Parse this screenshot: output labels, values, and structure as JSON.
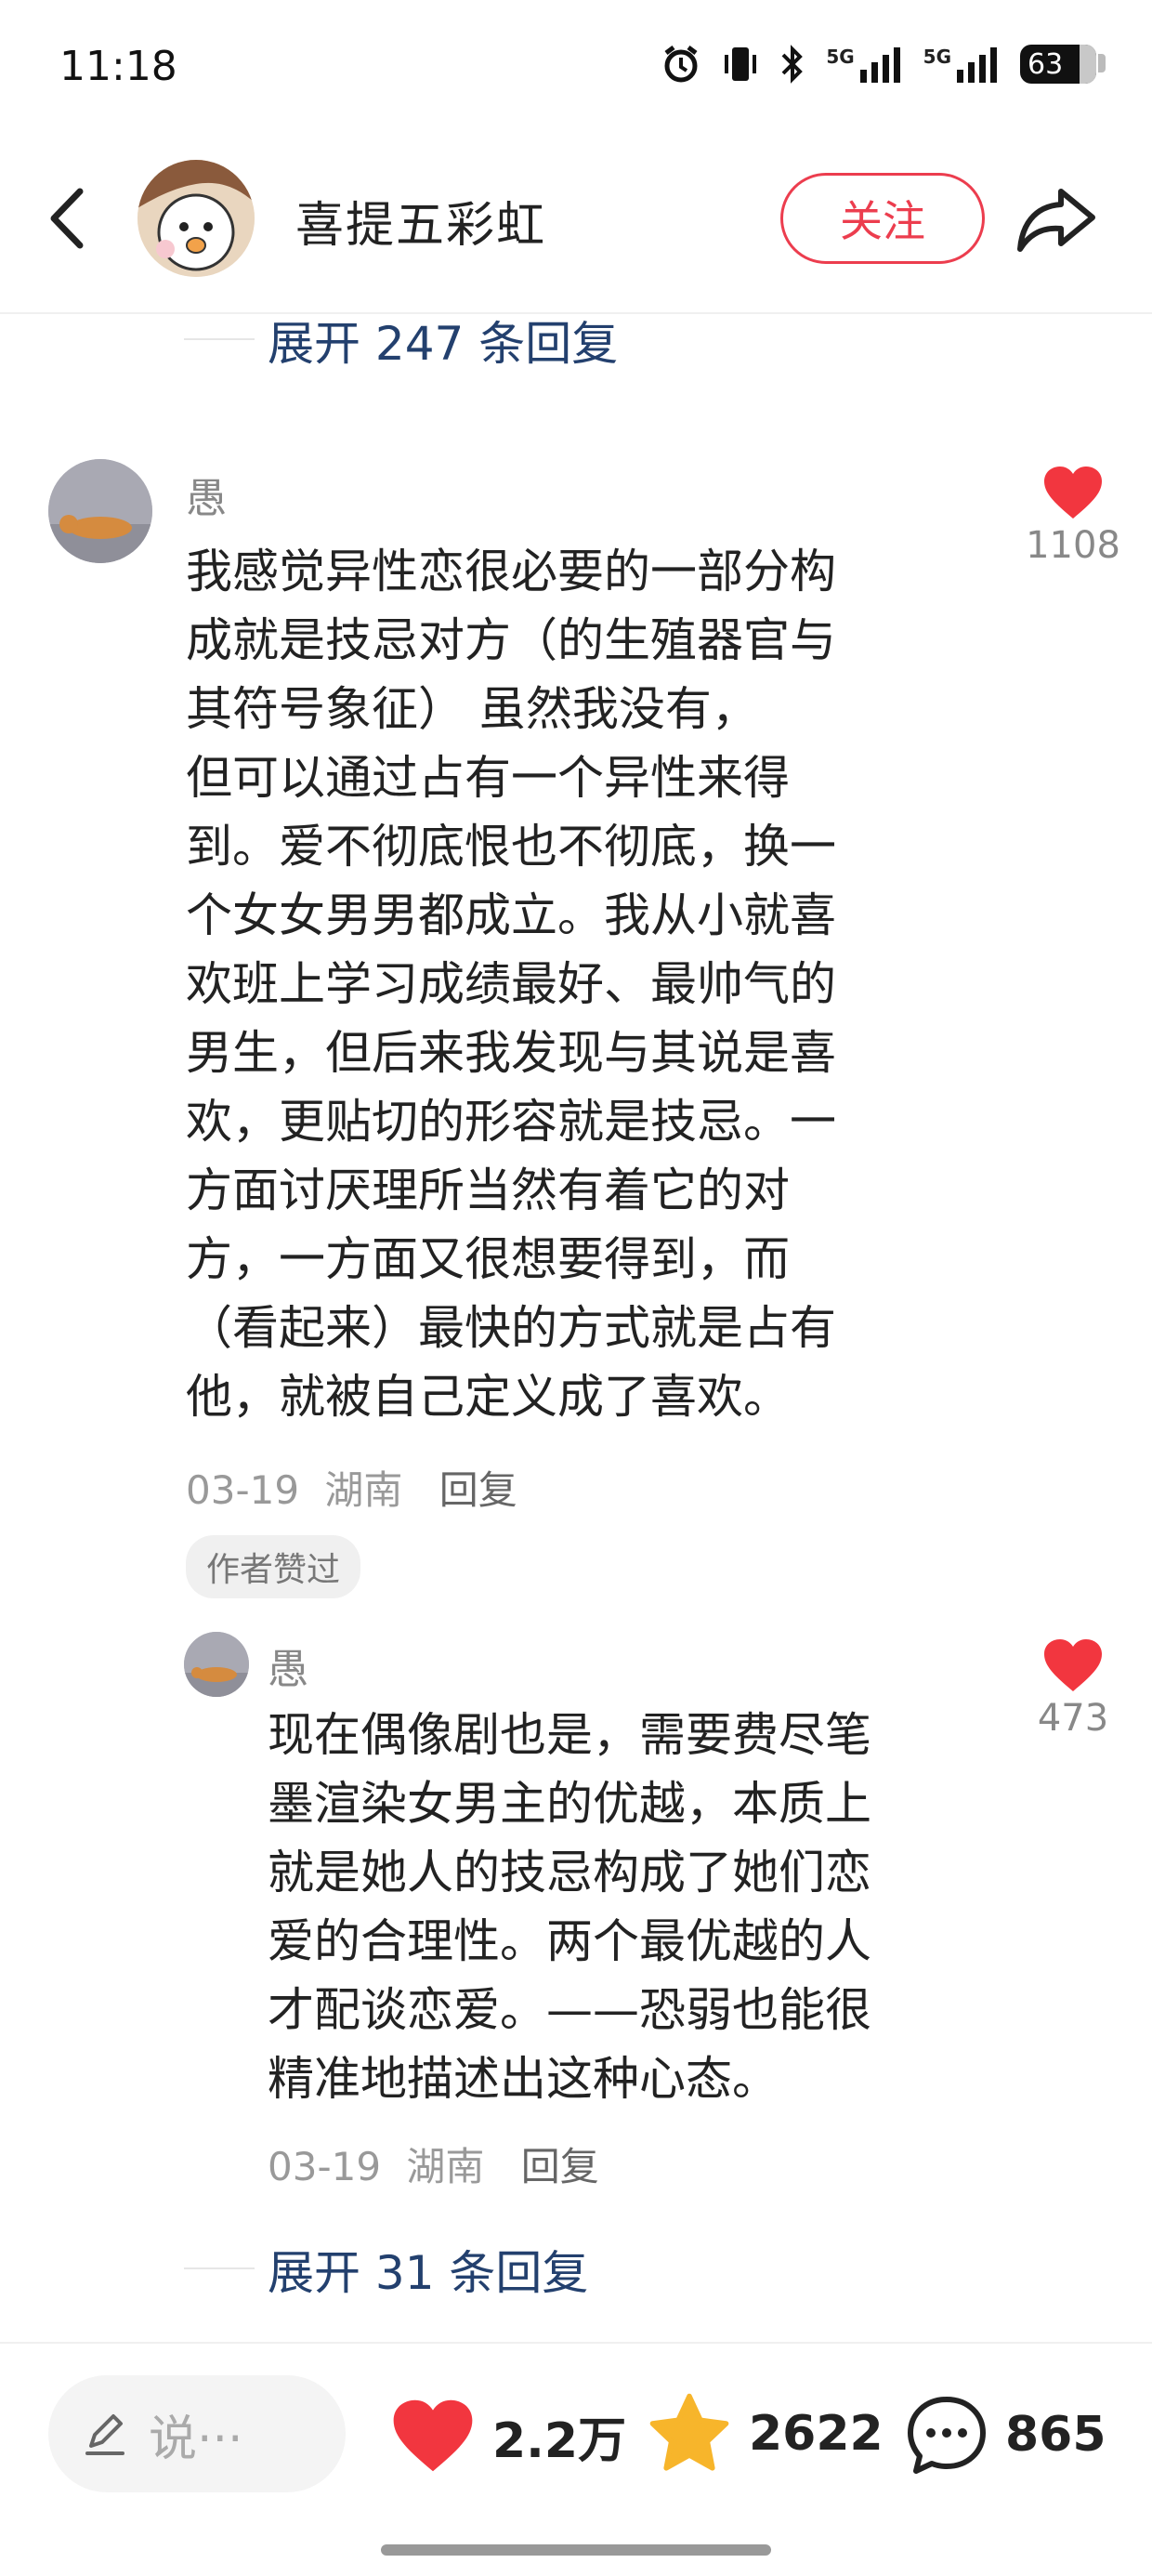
{
  "status_bar": {
    "time": "11:18",
    "battery": "63",
    "signal1": "5G",
    "signal2": "5G"
  },
  "header": {
    "author_name": "喜提五彩虹",
    "follow_label": "关注"
  },
  "top_expand": {
    "label": "展开 247 条回复"
  },
  "comment_main": {
    "name": "愚",
    "lines": [
      "我感觉异性恋很必要的一部分构",
      "成就是技忌对方（的生殖器官与",
      "其符号象征）     虽然我没有，",
      "但可以通过占有一个异性来得",
      "到。爱不彻底恨也不彻底，换一",
      "个女女男男都成立。我从小就喜",
      "欢班上学习成绩最好、最帅气的",
      "男生，但后来我发现与其说是喜",
      "欢，更贴切的形容就是技忌。一",
      "方面讨厌理所当然有着它的对",
      "方，一方面又很想要得到，而",
      "（看起来）最快的方式就是占有",
      "他，就被自己定义成了喜欢。"
    ],
    "date": "03-19",
    "location": "湖南",
    "reply_label": "回复",
    "badge": "作者赞过",
    "likes": "1108"
  },
  "comment_reply": {
    "name": "愚",
    "lines": [
      "现在偶像剧也是，需要费尽笔",
      "墨渲染女男主的优越，本质上",
      "就是她人的技忌构成了她们恋",
      "爱的合理性。两个最优越的人",
      "才配谈恋爱。——恐弱也能很",
      "精准地描述出这种心态。"
    ],
    "date": "03-19",
    "location": "湖南",
    "reply_label": "回复",
    "likes": "473"
  },
  "bottom_expand": {
    "label": "展开 31 条回复"
  },
  "bottom_bar": {
    "input_placeholder": "说···",
    "likes": "2.2万",
    "favorites": "2622",
    "comments": "865"
  },
  "colors": {
    "accent_red": "#ec3d4e",
    "link_blue": "#23406e",
    "star": "#f7b52b"
  },
  "icons": [
    "back-icon",
    "share-icon",
    "heart-icon",
    "star-icon",
    "comment-icon",
    "pencil-icon",
    "alarm-icon",
    "bluetooth-icon",
    "vibrate-icon"
  ]
}
